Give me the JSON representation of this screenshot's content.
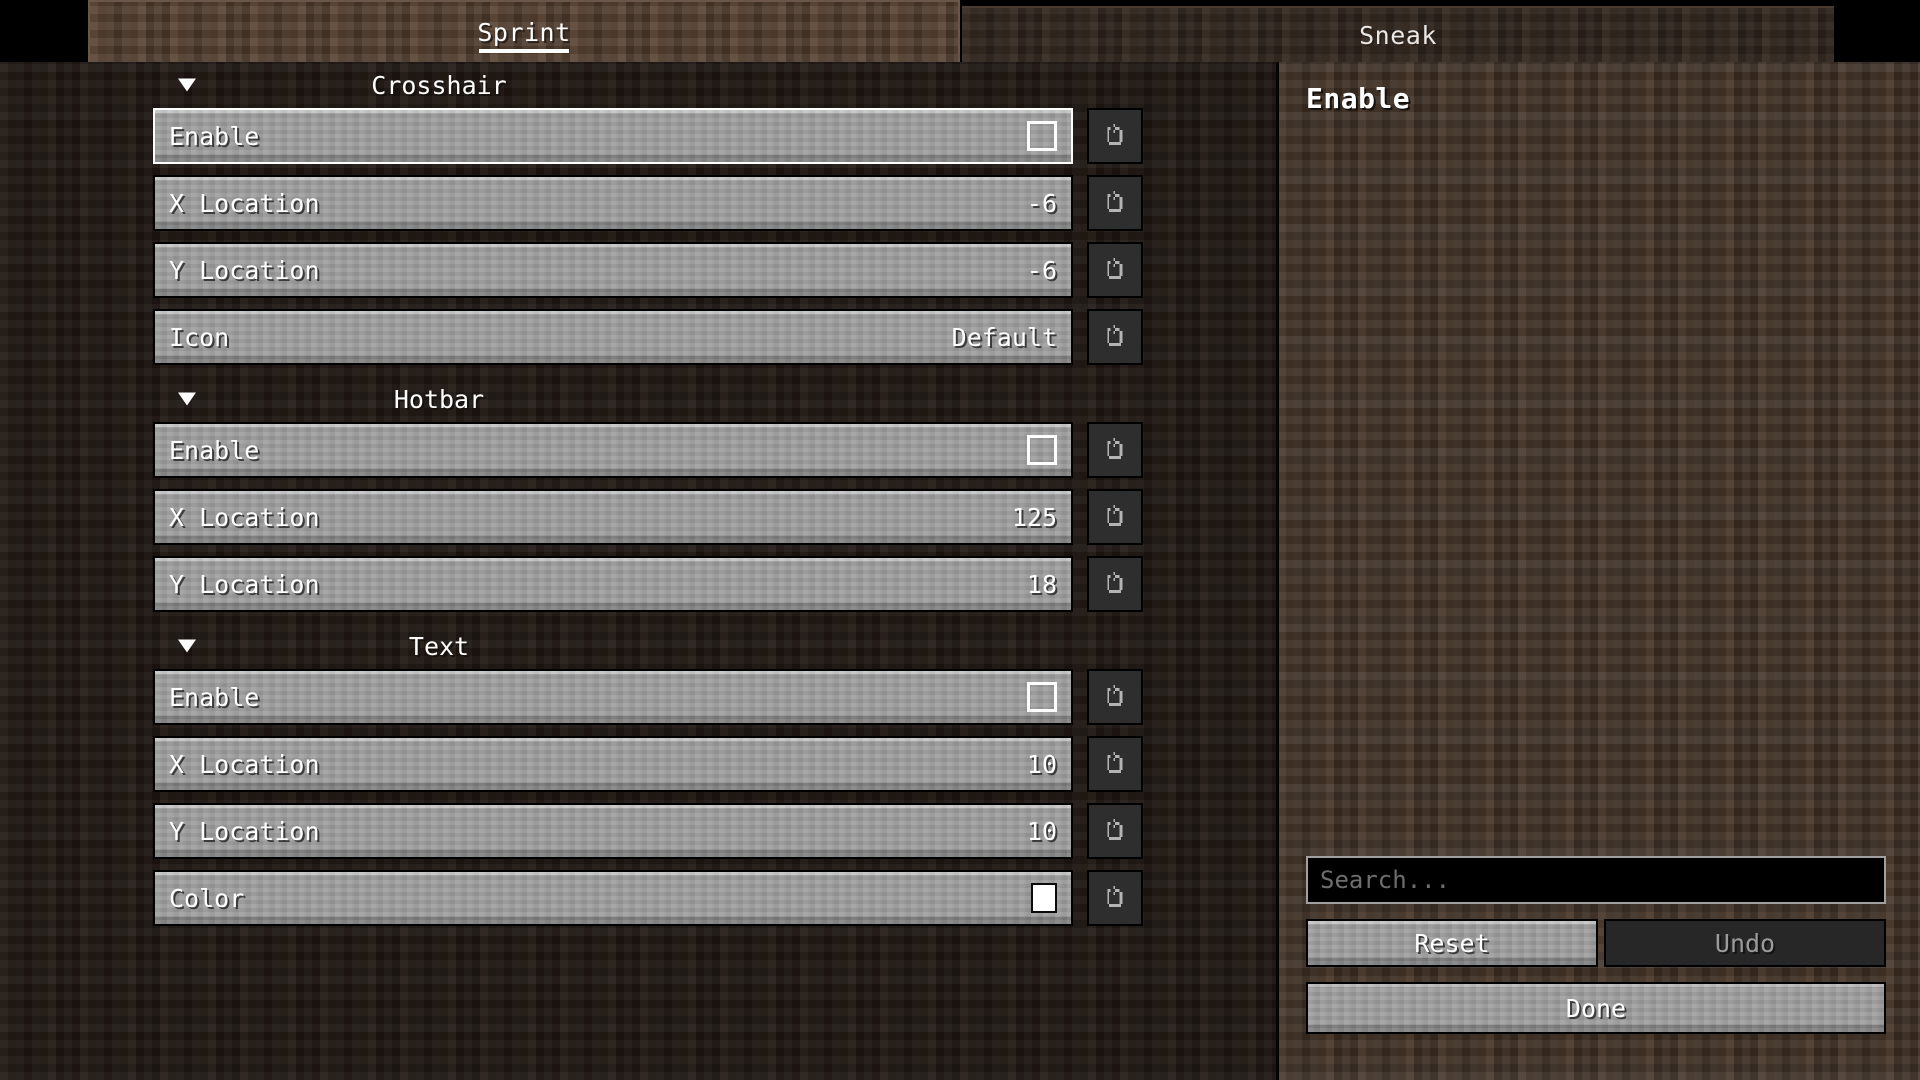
{
  "tabs": [
    {
      "label": "Sprint",
      "active": true
    },
    {
      "label": "Sneak",
      "active": false
    }
  ],
  "sections": [
    {
      "title": "Crosshair",
      "arrow_icon": "triangle-down-icon",
      "rows": [
        {
          "label": "Enable",
          "value": "",
          "control": "checkbox",
          "checked": false,
          "highlight": true,
          "reset_icon": "undo-arrow-icon"
        },
        {
          "label": "X Location",
          "value": "-6",
          "control": "text",
          "highlight": false,
          "reset_icon": "undo-arrow-icon"
        },
        {
          "label": "Y Location",
          "value": "-6",
          "control": "text",
          "highlight": false,
          "reset_icon": "undo-arrow-icon"
        },
        {
          "label": "Icon",
          "value": "Default",
          "control": "text",
          "highlight": false,
          "reset_icon": "undo-arrow-icon"
        }
      ]
    },
    {
      "title": "Hotbar",
      "arrow_icon": "triangle-down-icon",
      "rows": [
        {
          "label": "Enable",
          "value": "",
          "control": "checkbox",
          "checked": false,
          "highlight": false,
          "reset_icon": "undo-arrow-icon"
        },
        {
          "label": "X Location",
          "value": "125",
          "control": "text",
          "highlight": false,
          "reset_icon": "undo-arrow-icon"
        },
        {
          "label": "Y Location",
          "value": "18",
          "control": "text",
          "highlight": false,
          "reset_icon": "undo-arrow-icon"
        }
      ]
    },
    {
      "title": "Text",
      "arrow_icon": "triangle-down-icon",
      "rows": [
        {
          "label": "Enable",
          "value": "",
          "control": "checkbox",
          "checked": false,
          "highlight": false,
          "reset_icon": "undo-arrow-icon"
        },
        {
          "label": "X Location",
          "value": "10",
          "control": "text",
          "highlight": false,
          "reset_icon": "undo-arrow-icon"
        },
        {
          "label": "Y Location",
          "value": "10",
          "control": "text",
          "highlight": false,
          "reset_icon": "undo-arrow-icon"
        },
        {
          "label": "Color",
          "value": "",
          "control": "swatch",
          "swatch_color": "#ffffff",
          "highlight": false,
          "reset_icon": "undo-arrow-icon"
        }
      ]
    }
  ],
  "detail": {
    "title": "Enable"
  },
  "search": {
    "value": "",
    "placeholder": "Search..."
  },
  "buttons": {
    "reset": "Reset",
    "undo": "Undo",
    "done": "Done"
  },
  "colors": {
    "highlight_border": "#ffffff",
    "widget_face": "#9a9a9a",
    "reset_face": "#2e2e2e",
    "dirt_dark": "#1b1410",
    "dirt_mid": "#3a2c21",
    "swatch": "#ffffff"
  }
}
